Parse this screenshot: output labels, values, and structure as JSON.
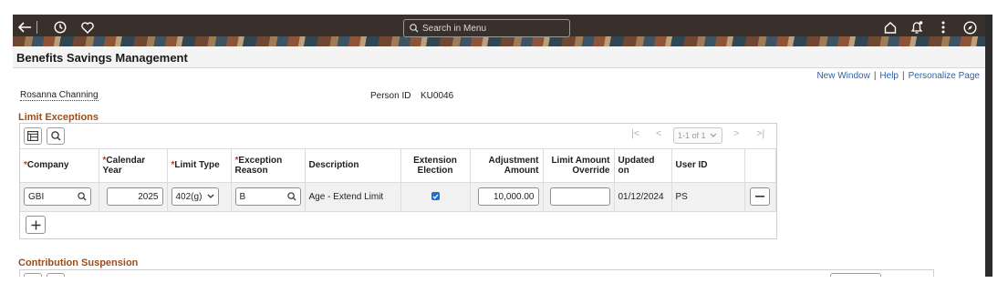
{
  "topnav": {
    "search_placeholder": "Search in Menu",
    "icons": [
      "back-arrow-icon",
      "history-icon",
      "favorites-heart-icon",
      "home-icon",
      "notifications-bell-icon",
      "more-options-icon",
      "navigator-compass-icon"
    ]
  },
  "page": {
    "title": "Benefits Savings Management"
  },
  "links": {
    "new_window": "New Window",
    "help": "Help",
    "personalize": "Personalize Page",
    "separator": "|"
  },
  "person": {
    "name": "Rosanna Channing",
    "id_label": "Person ID",
    "id_value": "KU0046"
  },
  "limit_exceptions": {
    "title": "Limit Exceptions",
    "pager": {
      "first": "|<",
      "prev": "<",
      "range": "1-1 of 1",
      "next": ">",
      "last": ">|"
    },
    "columns": {
      "company": "Company",
      "calendar_year": "Calendar Year",
      "limit_type": "Limit Type",
      "exception_reason": "Exception Reason",
      "description": "Description",
      "extension_election": "Extension Election",
      "adjustment_amount": "Adjustment Amount",
      "limit_amount_override": "Limit Amount Override",
      "updated_on": "Updated on",
      "user_id": "User ID"
    },
    "required_marker": "*",
    "rows": [
      {
        "company": "GBI",
        "calendar_year": "2025",
        "limit_type": "402(g)",
        "exception_reason": "B",
        "description": "Age - Extend Limit",
        "extension_election": true,
        "adjustment_amount": "10,000.00",
        "limit_amount_override": "",
        "updated_on": "01/12/2024",
        "user_id": "PS"
      }
    ]
  },
  "contribution_suspension": {
    "title": "Contribution Suspension"
  },
  "colors": {
    "section_title": "#9a4d1d",
    "link": "#2a62a8",
    "banner": "#3a302b",
    "checkbox": "#1a6fd1"
  }
}
